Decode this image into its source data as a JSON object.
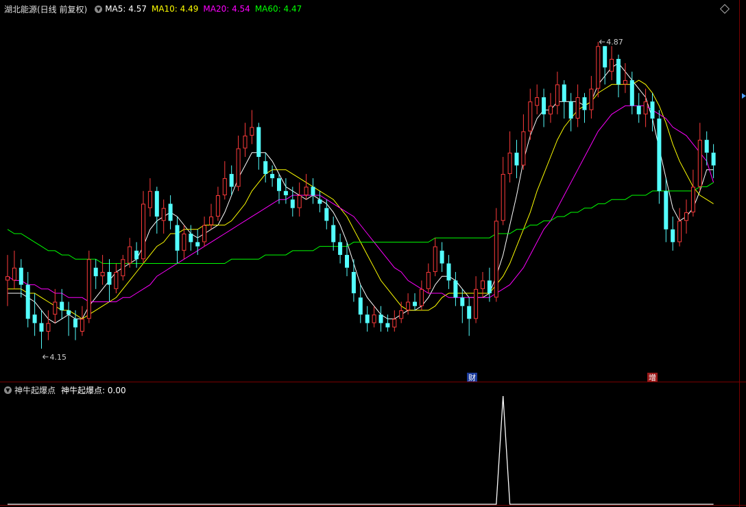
{
  "header": {
    "title": "湖北能源(日线 前复权)",
    "ma_items": [
      {
        "label": "MA5: 4.57",
        "color": "#ffffff"
      },
      {
        "label": "MA10: 4.49",
        "color": "#ffff00"
      },
      {
        "label": "MA20: 4.54",
        "color": "#ff00ff"
      },
      {
        "label": "MA60: 4.47",
        "color": "#00ff00"
      }
    ]
  },
  "sub_header": {
    "name": "神牛起爆点",
    "value_text": "神牛起爆点: 0.00"
  },
  "annotations": {
    "high_label": "4.87",
    "low_label": "4.15",
    "marker_cai": "财",
    "marker_zeng": "增"
  },
  "chart_data": [
    {
      "type": "candlestick",
      "title": "湖北能源(日线 前复权)",
      "colors": {
        "up": "#ff3b3b",
        "down": "#54ffff",
        "ma5": "#ffffff",
        "ma10": "#ffff00",
        "ma20": "#ff00ff",
        "ma60": "#00ff00"
      },
      "ylim": [
        4.1,
        4.92
      ],
      "candles": [
        [
          4.31,
          4.32,
          4.37,
          4.25
        ],
        [
          4.31,
          4.34,
          4.38,
          4.29
        ],
        [
          4.34,
          4.3,
          4.36,
          4.27
        ],
        [
          4.3,
          4.22,
          4.33,
          4.2
        ],
        [
          4.23,
          4.21,
          4.28,
          4.18
        ],
        [
          4.21,
          4.19,
          4.24,
          4.15
        ],
        [
          4.19,
          4.21,
          4.24,
          4.17
        ],
        [
          4.23,
          4.26,
          4.29,
          4.21
        ],
        [
          4.26,
          4.24,
          4.29,
          4.22
        ],
        [
          4.24,
          4.23,
          4.26,
          4.18
        ],
        [
          4.22,
          4.2,
          4.24,
          4.17
        ],
        [
          4.19,
          4.22,
          4.25,
          4.18
        ],
        [
          4.22,
          4.36,
          4.38,
          4.21
        ],
        [
          4.34,
          4.32,
          4.36,
          4.29
        ],
        [
          4.32,
          4.33,
          4.37,
          4.3
        ],
        [
          4.33,
          4.3,
          4.36,
          4.26
        ],
        [
          4.29,
          4.33,
          4.35,
          4.28
        ],
        [
          4.32,
          4.36,
          4.37,
          4.31
        ],
        [
          4.35,
          4.39,
          4.41,
          4.34
        ],
        [
          4.38,
          4.36,
          4.4,
          4.34
        ],
        [
          4.36,
          4.49,
          4.52,
          4.35
        ],
        [
          4.48,
          4.52,
          4.55,
          4.46
        ],
        [
          4.52,
          4.46,
          4.53,
          4.42
        ],
        [
          4.45,
          4.48,
          4.5,
          4.42
        ],
        [
          4.49,
          4.45,
          4.51,
          4.43
        ],
        [
          4.44,
          4.38,
          4.46,
          4.35
        ],
        [
          4.38,
          4.42,
          4.44,
          4.36
        ],
        [
          4.42,
          4.4,
          4.44,
          4.38
        ],
        [
          4.4,
          4.39,
          4.43,
          4.37
        ],
        [
          4.4,
          4.44,
          4.46,
          4.39
        ],
        [
          4.44,
          4.46,
          4.49,
          4.43
        ],
        [
          4.46,
          4.51,
          4.53,
          4.45
        ],
        [
          4.51,
          4.55,
          4.59,
          4.5
        ],
        [
          4.56,
          4.53,
          4.58,
          4.51
        ],
        [
          4.53,
          4.62,
          4.65,
          4.52
        ],
        [
          4.62,
          4.65,
          4.68,
          4.6
        ],
        [
          4.65,
          4.67,
          4.71,
          4.63
        ],
        [
          4.67,
          4.6,
          4.68,
          4.57
        ],
        [
          4.59,
          4.56,
          4.61,
          4.54
        ],
        [
          4.56,
          4.55,
          4.58,
          4.53
        ],
        [
          4.55,
          4.52,
          4.56,
          4.49
        ],
        [
          4.52,
          4.51,
          4.55,
          4.49
        ],
        [
          4.5,
          4.48,
          4.53,
          4.46
        ],
        [
          4.48,
          4.51,
          4.54,
          4.46
        ],
        [
          4.51,
          4.53,
          4.56,
          4.5
        ],
        [
          4.53,
          4.51,
          4.55,
          4.49
        ],
        [
          4.5,
          4.49,
          4.52,
          4.47
        ],
        [
          4.48,
          4.45,
          4.5,
          4.43
        ],
        [
          4.44,
          4.4,
          4.46,
          4.38
        ],
        [
          4.4,
          4.37,
          4.42,
          4.35
        ],
        [
          4.37,
          4.34,
          4.4,
          4.32
        ],
        [
          4.33,
          4.28,
          4.36,
          4.26
        ],
        [
          4.27,
          4.23,
          4.3,
          4.21
        ],
        [
          4.23,
          4.21,
          4.25,
          4.19
        ],
        [
          4.21,
          4.23,
          4.25,
          4.2
        ],
        [
          4.23,
          4.21,
          4.25,
          4.19
        ],
        [
          4.21,
          4.2,
          4.23,
          4.19
        ],
        [
          4.2,
          4.22,
          4.24,
          4.19
        ],
        [
          4.22,
          4.24,
          4.26,
          4.21
        ],
        [
          4.24,
          4.26,
          4.28,
          4.23
        ],
        [
          4.26,
          4.25,
          4.28,
          4.24
        ],
        [
          4.25,
          4.29,
          4.31,
          4.24
        ],
        [
          4.29,
          4.33,
          4.35,
          4.28
        ],
        [
          4.33,
          4.39,
          4.41,
          4.32
        ],
        [
          4.38,
          4.35,
          4.4,
          4.33
        ],
        [
          4.35,
          4.31,
          4.37,
          4.29
        ],
        [
          4.31,
          4.27,
          4.33,
          4.25
        ],
        [
          4.27,
          4.25,
          4.29,
          4.21
        ],
        [
          4.25,
          4.22,
          4.27,
          4.18
        ],
        [
          4.22,
          4.29,
          4.32,
          4.21
        ],
        [
          4.29,
          4.31,
          4.33,
          4.27
        ],
        [
          4.31,
          4.28,
          4.34,
          4.26
        ],
        [
          4.27,
          4.45,
          4.48,
          4.26
        ],
        [
          4.45,
          4.56,
          4.6,
          4.44
        ],
        [
          4.56,
          4.61,
          4.66,
          4.54
        ],
        [
          4.61,
          4.58,
          4.64,
          4.55
        ],
        [
          4.58,
          4.66,
          4.7,
          4.57
        ],
        [
          4.66,
          4.73,
          4.76,
          4.64
        ],
        [
          4.72,
          4.74,
          4.77,
          4.7
        ],
        [
          4.74,
          4.7,
          4.76,
          4.67
        ],
        [
          4.7,
          4.72,
          4.75,
          4.68
        ],
        [
          4.72,
          4.77,
          4.8,
          4.7
        ],
        [
          4.77,
          4.73,
          4.78,
          4.69
        ],
        [
          4.73,
          4.69,
          4.75,
          4.66
        ],
        [
          4.69,
          4.74,
          4.77,
          4.67
        ],
        [
          4.74,
          4.71,
          4.75,
          4.68
        ],
        [
          4.71,
          4.76,
          4.79,
          4.69
        ],
        [
          4.76,
          4.86,
          4.87,
          4.74
        ],
        [
          4.86,
          4.81,
          4.85,
          4.77
        ],
        [
          4.8,
          4.83,
          4.86,
          4.78
        ],
        [
          4.83,
          4.77,
          4.84,
          4.74
        ],
        [
          4.77,
          4.78,
          4.82,
          4.75
        ],
        [
          4.78,
          4.72,
          4.8,
          4.7
        ],
        [
          4.72,
          4.7,
          4.75,
          4.68
        ],
        [
          4.7,
          4.73,
          4.76,
          4.67
        ],
        [
          4.73,
          4.69,
          4.75,
          4.66
        ],
        [
          4.69,
          4.52,
          4.71,
          4.49
        ],
        [
          4.52,
          4.43,
          4.55,
          4.4
        ],
        [
          4.43,
          4.4,
          4.46,
          4.38
        ],
        [
          4.4,
          4.45,
          4.48,
          4.39
        ],
        [
          4.45,
          4.47,
          4.5,
          4.42
        ],
        [
          4.47,
          4.53,
          4.57,
          4.46
        ],
        [
          4.53,
          4.64,
          4.68,
          4.52
        ],
        [
          4.64,
          4.61,
          4.66,
          4.58
        ],
        [
          4.61,
          4.58,
          4.63,
          4.55
        ]
      ],
      "ma": {
        "MA5": [
          4.28,
          4.28,
          4.28,
          4.27,
          4.26,
          4.24,
          4.22,
          4.21,
          4.22,
          4.23,
          4.22,
          4.22,
          4.25,
          4.27,
          4.29,
          4.31,
          4.33,
          4.34,
          4.35,
          4.36,
          4.39,
          4.43,
          4.45,
          4.46,
          4.47,
          4.46,
          4.44,
          4.42,
          4.41,
          4.42,
          4.43,
          4.44,
          4.47,
          4.51,
          4.55,
          4.58,
          4.61,
          4.61,
          4.61,
          4.59,
          4.56,
          4.53,
          4.52,
          4.51,
          4.5,
          4.51,
          4.5,
          4.49,
          4.47,
          4.44,
          4.4,
          4.35,
          4.3,
          4.27,
          4.25,
          4.23,
          4.22,
          4.22,
          4.23,
          4.24,
          4.24,
          4.25,
          4.27,
          4.3,
          4.32,
          4.32,
          4.31,
          4.29,
          4.27,
          4.27,
          4.27,
          4.28,
          4.32,
          4.37,
          4.44,
          4.51,
          4.59,
          4.65,
          4.69,
          4.71,
          4.71,
          4.73,
          4.73,
          4.73,
          4.73,
          4.72,
          4.73,
          4.77,
          4.79,
          4.81,
          4.82,
          4.8,
          4.78,
          4.76,
          4.74,
          4.69,
          4.62,
          4.55,
          4.48,
          4.45,
          4.46,
          4.48,
          4.52,
          4.57,
          4.57
        ],
        "MA10": [
          4.29,
          4.29,
          4.29,
          4.28,
          4.28,
          4.27,
          4.26,
          4.25,
          4.24,
          4.24,
          4.23,
          4.22,
          4.23,
          4.24,
          4.25,
          4.26,
          4.27,
          4.29,
          4.31,
          4.33,
          4.35,
          4.37,
          4.39,
          4.4,
          4.42,
          4.42,
          4.43,
          4.43,
          4.43,
          4.44,
          4.44,
          4.44,
          4.44,
          4.45,
          4.47,
          4.49,
          4.52,
          4.54,
          4.56,
          4.57,
          4.57,
          4.57,
          4.56,
          4.55,
          4.54,
          4.53,
          4.52,
          4.51,
          4.5,
          4.48,
          4.46,
          4.43,
          4.4,
          4.37,
          4.34,
          4.31,
          4.29,
          4.27,
          4.25,
          4.24,
          4.24,
          4.24,
          4.24,
          4.25,
          4.27,
          4.28,
          4.28,
          4.28,
          4.28,
          4.28,
          4.28,
          4.28,
          4.3,
          4.32,
          4.35,
          4.39,
          4.43,
          4.47,
          4.52,
          4.56,
          4.6,
          4.64,
          4.67,
          4.69,
          4.71,
          4.72,
          4.73,
          4.75,
          4.76,
          4.77,
          4.77,
          4.77,
          4.77,
          4.78,
          4.77,
          4.75,
          4.72,
          4.68,
          4.63,
          4.59,
          4.56,
          4.53,
          4.51,
          4.5,
          4.49
        ],
        "MA20": [
          4.32,
          4.31,
          4.31,
          4.3,
          4.3,
          4.29,
          4.29,
          4.28,
          4.28,
          4.27,
          4.27,
          4.27,
          4.26,
          4.26,
          4.26,
          4.26,
          4.26,
          4.27,
          4.27,
          4.28,
          4.29,
          4.3,
          4.32,
          4.33,
          4.34,
          4.35,
          4.36,
          4.37,
          4.38,
          4.39,
          4.4,
          4.41,
          4.42,
          4.43,
          4.44,
          4.45,
          4.46,
          4.47,
          4.48,
          4.49,
          4.5,
          4.5,
          4.51,
          4.51,
          4.51,
          4.51,
          4.51,
          4.5,
          4.49,
          4.48,
          4.47,
          4.46,
          4.44,
          4.42,
          4.4,
          4.38,
          4.36,
          4.34,
          4.33,
          4.31,
          4.3,
          4.29,
          4.28,
          4.28,
          4.28,
          4.27,
          4.27,
          4.27,
          4.27,
          4.27,
          4.27,
          4.27,
          4.28,
          4.29,
          4.3,
          4.32,
          4.34,
          4.37,
          4.4,
          4.43,
          4.45,
          4.48,
          4.51,
          4.54,
          4.57,
          4.6,
          4.63,
          4.66,
          4.68,
          4.7,
          4.71,
          4.72,
          4.72,
          4.72,
          4.72,
          4.71,
          4.7,
          4.69,
          4.67,
          4.66,
          4.65,
          4.63,
          4.61,
          4.59,
          4.54
        ],
        "MA60": [
          4.43,
          4.42,
          4.42,
          4.41,
          4.4,
          4.39,
          4.38,
          4.38,
          4.37,
          4.37,
          4.36,
          4.36,
          4.36,
          4.36,
          4.35,
          4.35,
          4.35,
          4.35,
          4.35,
          4.35,
          4.35,
          4.35,
          4.35,
          4.35,
          4.35,
          4.35,
          4.35,
          4.35,
          4.35,
          4.35,
          4.35,
          4.35,
          4.35,
          4.36,
          4.36,
          4.36,
          4.36,
          4.36,
          4.37,
          4.37,
          4.37,
          4.37,
          4.38,
          4.38,
          4.38,
          4.38,
          4.39,
          4.39,
          4.39,
          4.39,
          4.39,
          4.4,
          4.4,
          4.4,
          4.4,
          4.4,
          4.4,
          4.4,
          4.4,
          4.4,
          4.4,
          4.4,
          4.4,
          4.41,
          4.41,
          4.41,
          4.41,
          4.41,
          4.41,
          4.41,
          4.41,
          4.41,
          4.42,
          4.42,
          4.42,
          4.43,
          4.43,
          4.44,
          4.44,
          4.45,
          4.45,
          4.46,
          4.46,
          4.47,
          4.47,
          4.48,
          4.48,
          4.49,
          4.49,
          4.5,
          4.5,
          4.5,
          4.51,
          4.51,
          4.51,
          4.52,
          4.52,
          4.52,
          4.52,
          4.52,
          4.52,
          4.52,
          4.53,
          4.53,
          4.54
        ]
      },
      "annotations": [
        {
          "text": "4.87",
          "index": 87,
          "price": 4.87
        },
        {
          "text": "4.15",
          "index": 5,
          "price": 4.15
        }
      ]
    },
    {
      "type": "line",
      "title": "神牛起爆点",
      "series": [
        {
          "name": "神牛起爆点",
          "color": "#ffffff",
          "values": [
            0,
            0,
            0,
            0,
            0,
            0,
            0,
            0,
            0,
            0,
            0,
            0,
            0,
            0,
            0,
            0,
            0,
            0,
            0,
            0,
            0,
            0,
            0,
            0,
            0,
            0,
            0,
            0,
            0,
            0,
            0,
            0,
            0,
            0,
            0,
            0,
            0,
            0,
            0,
            0,
            0,
            0,
            0,
            0,
            0,
            0,
            0,
            0,
            0,
            0,
            0,
            0,
            0,
            0,
            0,
            0,
            0,
            0,
            0,
            0,
            0,
            0,
            0,
            0,
            0,
            0,
            0,
            0,
            0,
            0,
            0,
            0,
            0,
            1,
            0,
            0,
            0,
            0,
            0,
            0,
            0,
            0,
            0,
            0,
            0,
            0,
            0,
            0,
            0,
            0,
            0,
            0,
            0,
            0,
            0,
            0,
            0,
            0,
            0,
            0,
            0,
            0,
            0,
            0,
            0
          ]
        }
      ],
      "ylim": [
        0,
        1
      ]
    }
  ]
}
